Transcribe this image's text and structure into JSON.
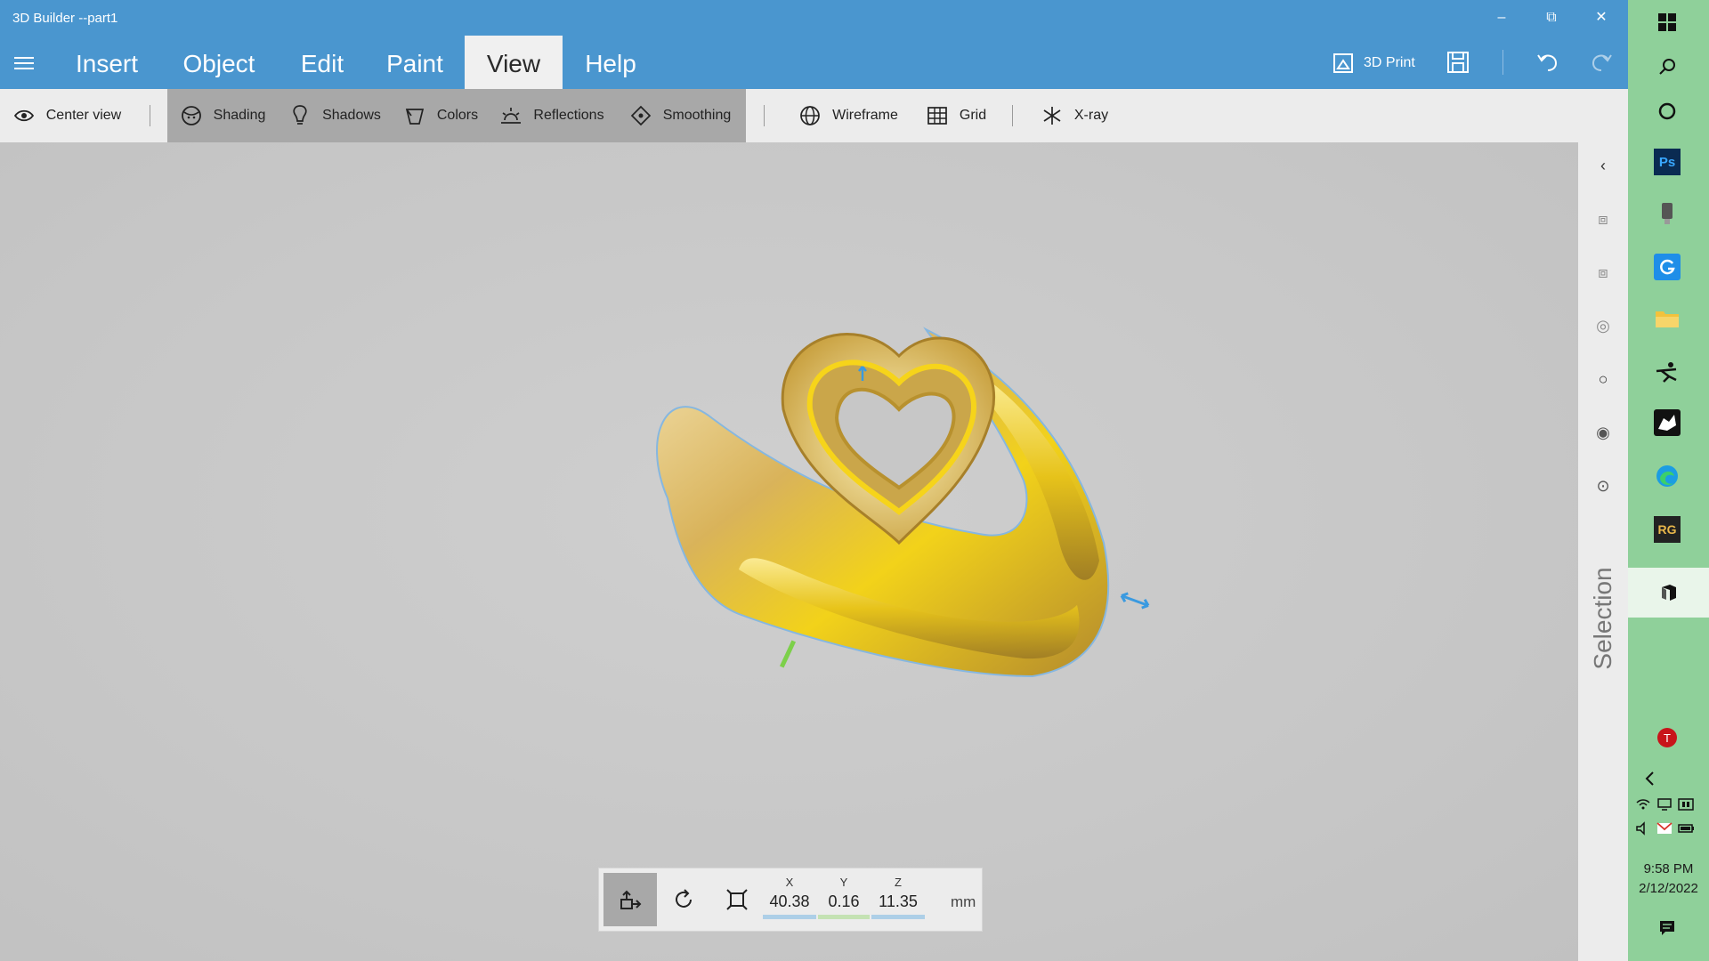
{
  "window": {
    "title": "3D Builder --part1"
  },
  "menu": {
    "tabs": [
      {
        "label": "Insert"
      },
      {
        "label": "Object"
      },
      {
        "label": "Edit"
      },
      {
        "label": "Paint"
      },
      {
        "label": "View",
        "active": true
      },
      {
        "label": "Help"
      }
    ],
    "print_label": "3D Print"
  },
  "toolbar": {
    "center_view": "Center view",
    "shading": "Shading",
    "shadows": "Shadows",
    "colors": "Colors",
    "reflections": "Reflections",
    "smoothing": "Smoothing",
    "wireframe": "Wireframe",
    "grid": "Grid",
    "xray": "X-ray",
    "toggled": [
      "Shading",
      "Shadows",
      "Colors",
      "Reflections",
      "Smoothing"
    ]
  },
  "selection_panel": {
    "label": "Selection"
  },
  "transform": {
    "x_label": "X",
    "x_value": "40.38",
    "y_label": "Y",
    "y_value": "0.16",
    "z_label": "Z",
    "z_value": "11.35",
    "unit": "mm"
  },
  "taskbar": {
    "time": "9:58 PM",
    "date": "2/12/2022",
    "apps": [
      "windows-start-icon",
      "search-icon",
      "cortana-icon",
      "photoshop-icon",
      "usb-device-icon",
      "g-app-icon",
      "file-explorer-icon",
      "zbrush-icon",
      "rhino-icon",
      "edge-icon",
      "rg-app-icon",
      "3d-builder-icon"
    ]
  },
  "colors": {
    "accent": "#4a96cf",
    "toolbar_bg": "#ececec",
    "viewport_bg": "#c9c9c9",
    "taskbar_bg": "#8fd09a"
  }
}
